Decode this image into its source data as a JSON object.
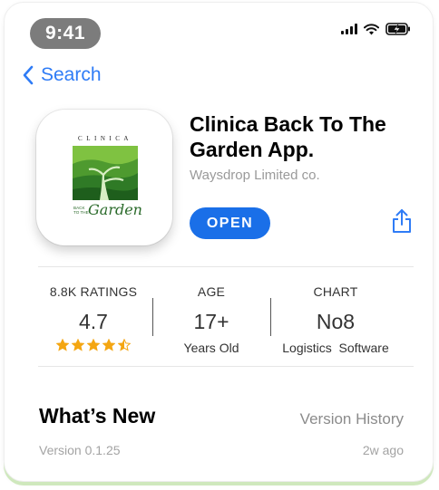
{
  "status_bar": {
    "time": "9:41",
    "icons": [
      "signal-icon",
      "wifi-icon",
      "battery-charging-icon"
    ]
  },
  "nav": {
    "back_label": "Search",
    "back_icon": "chevron-left-icon"
  },
  "app": {
    "title": "Clinica Back To The Garden App.",
    "developer": "Waysdrop Limited co.",
    "open_label": "OPEN",
    "share_icon": "share-icon",
    "icon_text": {
      "clinica": "CLINICA",
      "back_to_the": "BACK TO THE",
      "garden": "Garden"
    }
  },
  "stats": {
    "ratings": {
      "label": "8.8K RATINGS",
      "value": "4.7",
      "stars": 4.5
    },
    "age": {
      "label": "AGE",
      "value": "17+",
      "sub": "Years Old"
    },
    "chart": {
      "label": "CHART",
      "value": "No8",
      "sub": "Logistics  Software"
    }
  },
  "whats_new": {
    "title": "What’s New",
    "history_label": "Version History",
    "version": "Version 0.1.25",
    "ago": "2w ago"
  },
  "colors": {
    "accent": "#1a6fe8",
    "link": "#2f7cf6",
    "star": "#f4a612",
    "frame_shadow": "#cfe8bd"
  }
}
